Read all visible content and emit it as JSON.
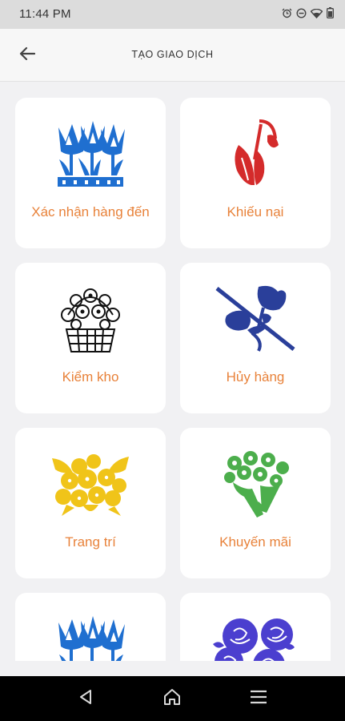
{
  "status_bar": {
    "time": "11:44 PM",
    "icons": [
      "alarm-icon",
      "do-not-disturb-icon",
      "wifi-icon",
      "battery-icon"
    ]
  },
  "app_bar": {
    "title": "TẠO GIAO DỊCH",
    "back_icon": "arrow-left-icon"
  },
  "colors": {
    "label": "#e8823a",
    "blue_flower": "#1f6fd0",
    "red_flower": "#d42b2b",
    "navy_flower": "#2a3f9a",
    "yellow_flower": "#f0c419",
    "green_flower": "#4cae4c",
    "purple_flower": "#4b3fcf"
  },
  "cards": [
    {
      "label": "Xác nhận hàng đến",
      "icon": "blue-flowers-icon"
    },
    {
      "label": "Khiếu nại",
      "icon": "red-snowdrop-icon"
    },
    {
      "label": "Kiểm kho",
      "icon": "flower-basket-icon"
    },
    {
      "label": "Hủy hàng",
      "icon": "crossed-flower-icon"
    },
    {
      "label": "Trang trí",
      "icon": "yellow-flowers-icon"
    },
    {
      "label": "Khuyến mãi",
      "icon": "green-bouquet-icon"
    },
    {
      "label": "",
      "icon": "blue-flowers-icon"
    },
    {
      "label": "",
      "icon": "purple-roses-icon"
    }
  ],
  "nav_bar": {
    "buttons": [
      "back-triangle-icon",
      "home-icon",
      "menu-icon"
    ]
  }
}
